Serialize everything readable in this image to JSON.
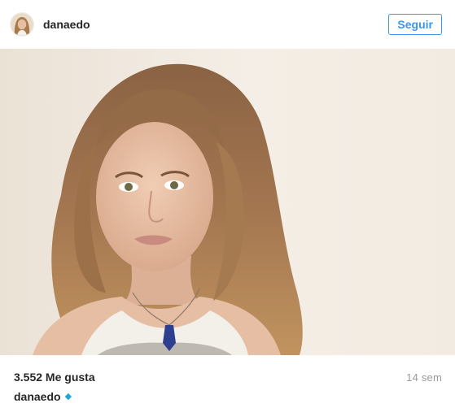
{
  "header": {
    "username": "danaedo",
    "follow_label": "Seguir"
  },
  "post": {
    "photo_icon": "portrait-photo",
    "likes_text": "3.552 Me gusta",
    "time_ago": "14 sem",
    "caption_user": "danaedo",
    "caption_emoji": "◆"
  },
  "colors": {
    "accent": "#3897f0",
    "text": "#262626",
    "muted": "#999999",
    "caption_emoji": "#20a7d6"
  }
}
